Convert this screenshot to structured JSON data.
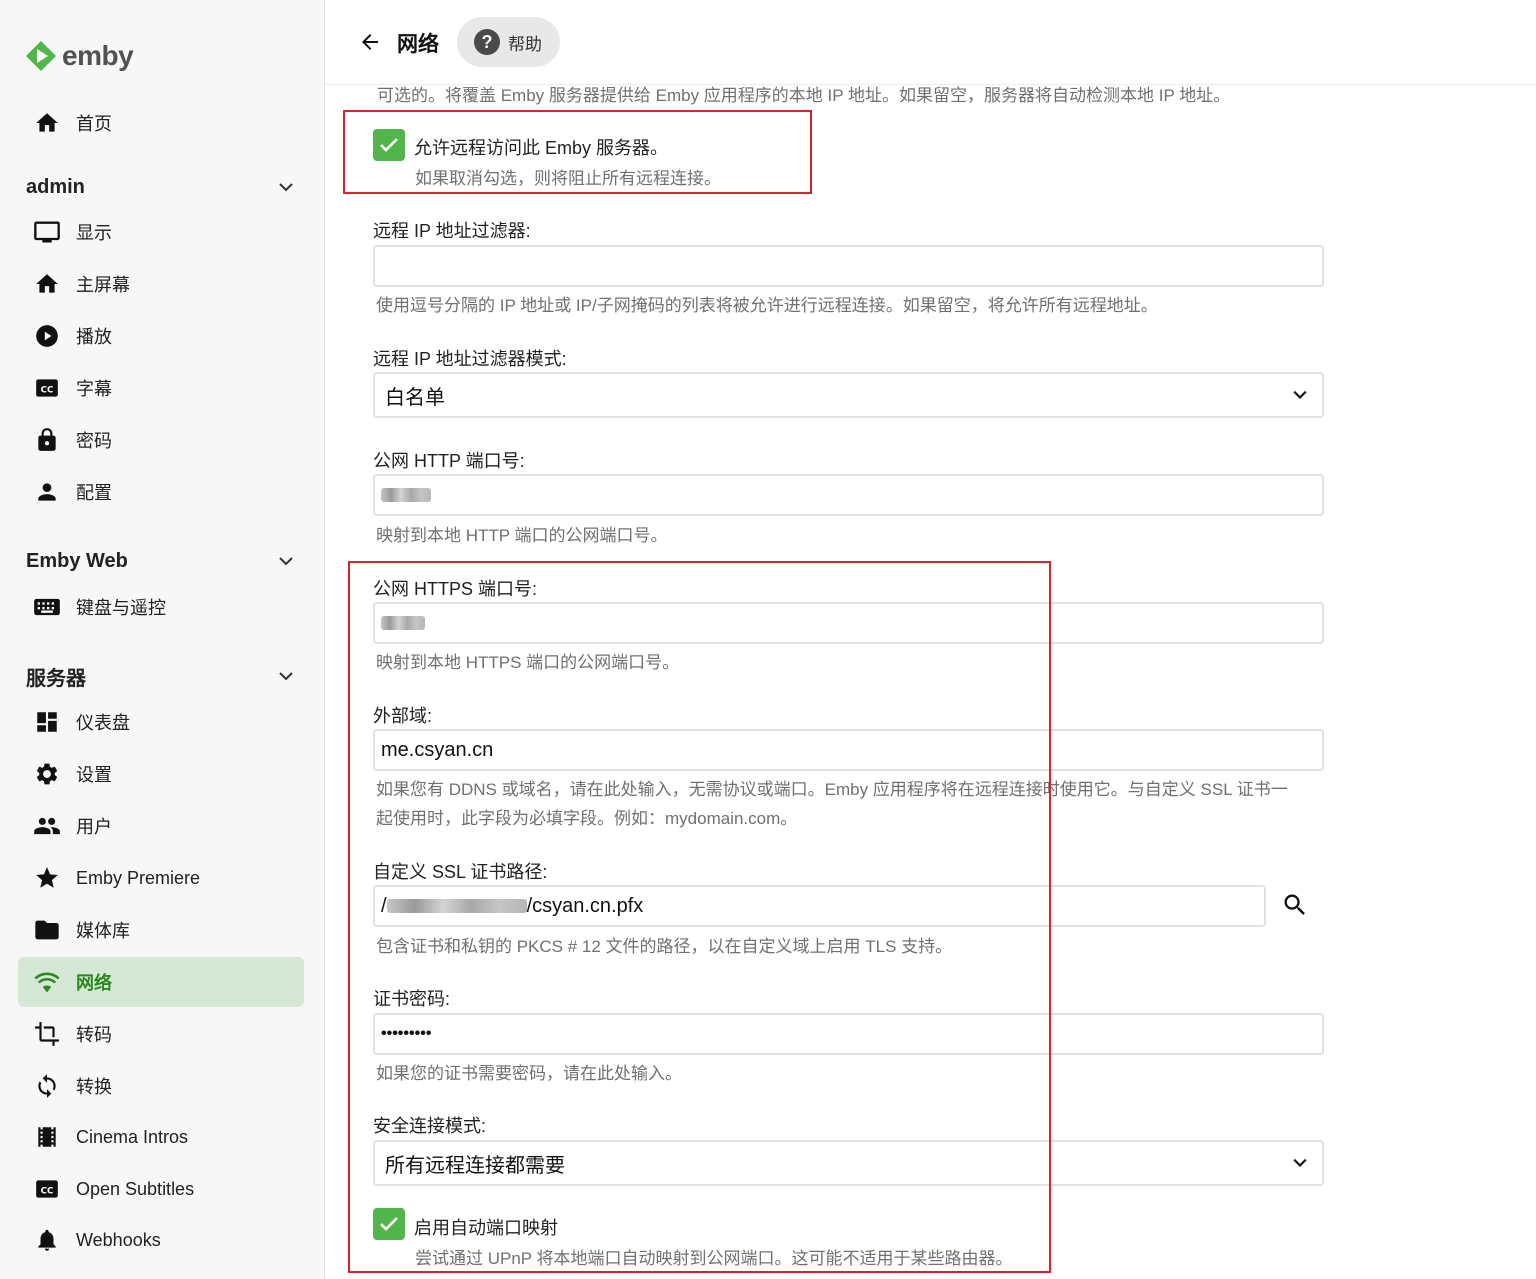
{
  "app": {
    "logo_text": "emby"
  },
  "sidebar": {
    "home": "首页",
    "sections": [
      {
        "title": "admin",
        "items": [
          "显示",
          "主屏幕",
          "播放",
          "字幕",
          "密码",
          "配置"
        ]
      },
      {
        "title": "Emby Web",
        "items": [
          "键盘与遥控"
        ]
      },
      {
        "title": "服务器",
        "items": [
          "仪表盘",
          "设置",
          "用户",
          "Emby Premiere",
          "媒体库",
          "网络",
          "转码",
          "转换",
          "Cinema Intros",
          "Open Subtitles",
          "Webhooks"
        ]
      }
    ],
    "active_item": "网络"
  },
  "header": {
    "title": "网络",
    "help_label": "帮助"
  },
  "form": {
    "top_hint": "可选的。将覆盖 Emby 服务器提供给 Emby 应用程序的本地 IP 地址。如果留空，服务器将自动检测本地 IP 地址。",
    "allow_remote": {
      "label": "允许远程访问此 Emby 服务器。",
      "hint": "如果取消勾选，则将阻止所有远程连接。",
      "checked": true
    },
    "ip_filter": {
      "label": "远程 IP 地址过滤器:",
      "value": "",
      "hint": "使用逗号分隔的 IP 地址或 IP/子网掩码的列表将被允许进行远程连接。如果留空，将允许所有远程地址。"
    },
    "ip_filter_mode": {
      "label": "远程 IP 地址过滤器模式:",
      "value": "白名单"
    },
    "public_http": {
      "label": "公网 HTTP 端口号:",
      "hint": "映射到本地 HTTP 端口的公网端口号。"
    },
    "public_https": {
      "label": "公网 HTTPS 端口号:",
      "hint": "映射到本地 HTTPS 端口的公网端口号。"
    },
    "external_domain": {
      "label": "外部域:",
      "value": "me.csyan.cn",
      "hint_line1": "如果您有 DDNS 或域名，请在此处输入，无需协议或端口。Emby 应用程序将在远程连接时使用它。与自定义 SSL 证书一",
      "hint_line2": "起使用时，此字段为必填字段。例如：mydomain.com。"
    },
    "ssl_cert_path": {
      "label": "自定义 SSL 证书路径:",
      "value_prefix": "/",
      "value_suffix": "/csyan.cn.pfx",
      "hint": "包含证书和私钥的 PKCS # 12 文件的路径，以在自定义域上启用 TLS 支持。"
    },
    "cert_password": {
      "label": "证书密码:",
      "value": "•••••••••",
      "hint": "如果您的证书需要密码，请在此处输入。"
    },
    "secure_mode": {
      "label": "安全连接模式:",
      "value": "所有远程连接都需要"
    },
    "upnp": {
      "label": "启用自动端口映射",
      "hint": "尝试通过 UPnP 将本地端口自动映射到公网端口。这可能不适用于某些路由器。",
      "checked": true
    }
  },
  "colors": {
    "accent": "#52b54b",
    "active_bg": "#d5e8d5",
    "active_text": "#2b8a1e",
    "highlight_box": "#d9222c"
  }
}
